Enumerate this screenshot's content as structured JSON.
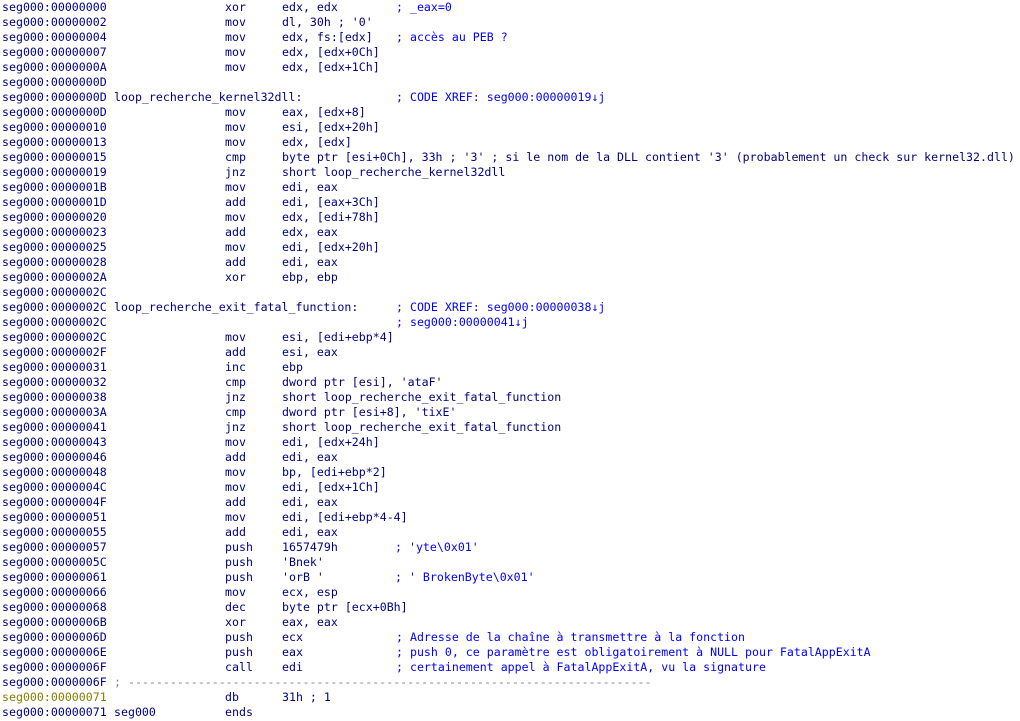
{
  "lines": [
    {
      "addr": "seg000:00000000",
      "addr_type": "code",
      "mnemonic": "xor",
      "operands": "edx, edx",
      "comment": "; _eax=0",
      "comment_x": "c1"
    },
    {
      "addr": "seg000:00000002",
      "addr_type": "code",
      "mnemonic": "mov",
      "operands": "dl, 30h ; '0'"
    },
    {
      "addr": "seg000:00000004",
      "addr_type": "code",
      "mnemonic": "mov",
      "operands": "edx, fs:[edx]",
      "comment": "; accès au PEB ?",
      "comment_x": "c1"
    },
    {
      "addr": "seg000:00000007",
      "addr_type": "code",
      "mnemonic": "mov",
      "operands": "edx, [edx+0Ch]"
    },
    {
      "addr": "seg000:0000000A",
      "addr_type": "code",
      "mnemonic": "mov",
      "operands": "edx, [edx+1Ch]"
    },
    {
      "addr": "seg000:0000000D",
      "addr_type": "code"
    },
    {
      "addr": "seg000:0000000D",
      "addr_type": "code",
      "label": "loop_recherche_kernel32dll:",
      "comment": "; CODE XREF: seg000:00000019↓j",
      "comment_x": "c1"
    },
    {
      "addr": "seg000:0000000D",
      "addr_type": "code",
      "mnemonic": "mov",
      "operands": "eax, [edx+8]"
    },
    {
      "addr": "seg000:00000010",
      "addr_type": "code",
      "mnemonic": "mov",
      "operands": "esi, [edx+20h]"
    },
    {
      "addr": "seg000:00000013",
      "addr_type": "code",
      "mnemonic": "mov",
      "operands": "edx, [edx]"
    },
    {
      "addr": "seg000:00000015",
      "addr_type": "code",
      "mnemonic": "cmp",
      "operands": "byte ptr [esi+0Ch], 33h ; '3' ; si le nom de la DLL contient '3' (probablement un check sur kernel32.dll)"
    },
    {
      "addr": "seg000:00000019",
      "addr_type": "code",
      "mnemonic": "jnz",
      "operands": "short loop_recherche_kernel32dll"
    },
    {
      "addr": "seg000:0000001B",
      "addr_type": "code",
      "mnemonic": "mov",
      "operands": "edi, eax"
    },
    {
      "addr": "seg000:0000001D",
      "addr_type": "code",
      "mnemonic": "add",
      "operands": "edi, [eax+3Ch]"
    },
    {
      "addr": "seg000:00000020",
      "addr_type": "code",
      "mnemonic": "mov",
      "operands": "edx, [edi+78h]"
    },
    {
      "addr": "seg000:00000023",
      "addr_type": "code",
      "mnemonic": "add",
      "operands": "edx, eax"
    },
    {
      "addr": "seg000:00000025",
      "addr_type": "code",
      "mnemonic": "mov",
      "operands": "edi, [edx+20h]"
    },
    {
      "addr": "seg000:00000028",
      "addr_type": "code",
      "mnemonic": "add",
      "operands": "edi, eax"
    },
    {
      "addr": "seg000:0000002A",
      "addr_type": "code",
      "mnemonic": "xor",
      "operands": "ebp, ebp"
    },
    {
      "addr": "seg000:0000002C",
      "addr_type": "code"
    },
    {
      "addr": "seg000:0000002C",
      "addr_type": "code",
      "label": "loop_recherche_exit_fatal_function:",
      "comment": "; CODE XREF: seg000:00000038↓j",
      "comment_x": "c1"
    },
    {
      "addr": "seg000:0000002C",
      "addr_type": "code",
      "comment": "; seg000:00000041↓j",
      "comment_x": "c1"
    },
    {
      "addr": "seg000:0000002C",
      "addr_type": "code",
      "mnemonic": "mov",
      "operands": "esi, [edi+ebp*4]"
    },
    {
      "addr": "seg000:0000002F",
      "addr_type": "code",
      "mnemonic": "add",
      "operands": "esi, eax"
    },
    {
      "addr": "seg000:00000031",
      "addr_type": "code",
      "mnemonic": "inc",
      "operands": "ebp"
    },
    {
      "addr": "seg000:00000032",
      "addr_type": "code",
      "mnemonic": "cmp",
      "operands": "dword ptr [esi], 'ataF'"
    },
    {
      "addr": "seg000:00000038",
      "addr_type": "code",
      "mnemonic": "jnz",
      "operands": "short loop_recherche_exit_fatal_function"
    },
    {
      "addr": "seg000:0000003A",
      "addr_type": "code",
      "mnemonic": "cmp",
      "operands": "dword ptr [esi+8], 'tixE'"
    },
    {
      "addr": "seg000:00000041",
      "addr_type": "code",
      "mnemonic": "jnz",
      "operands": "short loop_recherche_exit_fatal_function"
    },
    {
      "addr": "seg000:00000043",
      "addr_type": "code",
      "mnemonic": "mov",
      "operands": "edi, [edx+24h]"
    },
    {
      "addr": "seg000:00000046",
      "addr_type": "code",
      "mnemonic": "add",
      "operands": "edi, eax"
    },
    {
      "addr": "seg000:00000048",
      "addr_type": "code",
      "mnemonic": "mov",
      "operands": "bp, [edi+ebp*2]"
    },
    {
      "addr": "seg000:0000004C",
      "addr_type": "code",
      "mnemonic": "mov",
      "operands": "edi, [edx+1Ch]"
    },
    {
      "addr": "seg000:0000004F",
      "addr_type": "code",
      "mnemonic": "add",
      "operands": "edi, eax"
    },
    {
      "addr": "seg000:00000051",
      "addr_type": "code",
      "mnemonic": "mov",
      "operands": "edi, [edi+ebp*4-4]"
    },
    {
      "addr": "seg000:00000055",
      "addr_type": "code",
      "mnemonic": "add",
      "operands": "edi, eax"
    },
    {
      "addr": "seg000:00000057",
      "addr_type": "code",
      "mnemonic": "push",
      "operands": "1657479h",
      "comment": "; 'yte\\0x01'",
      "comment_x": "c2"
    },
    {
      "addr": "seg000:0000005C",
      "addr_type": "code",
      "mnemonic": "push",
      "operands": "'Bnek'"
    },
    {
      "addr": "seg000:00000061",
      "addr_type": "code",
      "mnemonic": "push",
      "operands": "'orB '",
      "comment": "; ' BrokenByte\\0x01'",
      "comment_x": "c2"
    },
    {
      "addr": "seg000:00000066",
      "addr_type": "code",
      "mnemonic": "mov",
      "operands": "ecx, esp"
    },
    {
      "addr": "seg000:00000068",
      "addr_type": "code",
      "mnemonic": "dec",
      "operands": "byte ptr [ecx+0Bh]"
    },
    {
      "addr": "seg000:0000006B",
      "addr_type": "code",
      "mnemonic": "xor",
      "operands": "eax, eax"
    },
    {
      "addr": "seg000:0000006D",
      "addr_type": "code",
      "mnemonic": "push",
      "operands": "ecx",
      "comment": "; Adresse de la chaîne à transmettre à la fonction",
      "comment_x": "c1"
    },
    {
      "addr": "seg000:0000006E",
      "addr_type": "code",
      "mnemonic": "push",
      "operands": "eax",
      "comment": "; push 0, ce paramètre est obligatoirement à NULL pour FatalAppExitA",
      "comment_x": "c1"
    },
    {
      "addr": "seg000:0000006F",
      "addr_type": "code",
      "mnemonic": "call",
      "operands": "edi",
      "comment": "; certainement appel à FatalAppExitA, vu la signature",
      "comment_x": "c1"
    },
    {
      "addr": "seg000:0000006F",
      "addr_type": "sep",
      "separator": "; ---------------------------------------------------------------------------"
    },
    {
      "addr": "seg000:00000071",
      "addr_type": "data",
      "mnemonic": "db",
      "operands": "31h ; 1"
    },
    {
      "addr": "seg000:00000071",
      "addr_type": "code",
      "label": "seg000",
      "mnemonic": "ends"
    }
  ],
  "colors": {
    "code_addr": "#000080",
    "data_addr": "#808000",
    "instruction": "#000080",
    "comment": "#0000ff",
    "separator": "#8080a0",
    "background": "#ffffff"
  }
}
